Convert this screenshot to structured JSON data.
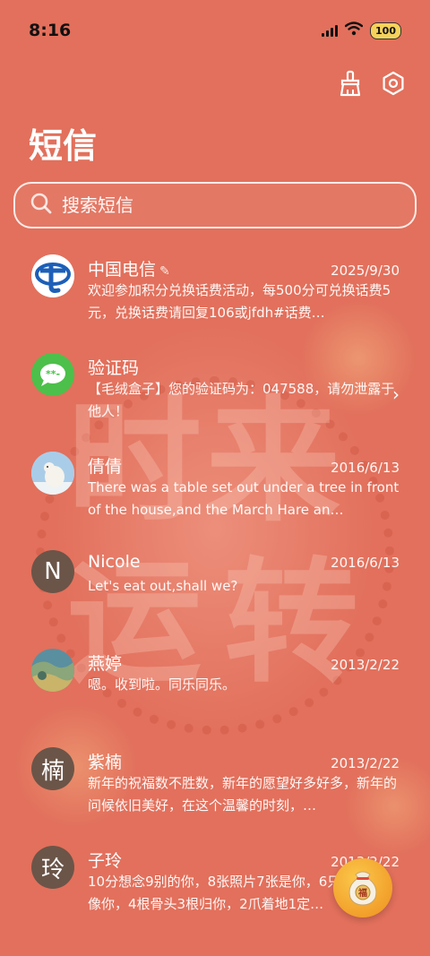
{
  "status": {
    "time": "8:16",
    "battery": "100"
  },
  "header": {
    "title": "短信"
  },
  "search": {
    "placeholder": "搜索短信"
  },
  "conversations": [
    {
      "name": "中国电信",
      "date": "2025/9/30",
      "preview": "欢迎参加积分兑换话费活动，每500分可兑换话费5元，兑换话费请回复106或jfdh#话费…",
      "avatar": "telecom-logo"
    },
    {
      "name": "验证码",
      "date": "",
      "preview": "【毛绒盒子】您的验证码为：047588，请勿泄露于他人！",
      "avatar": "message-bubble"
    },
    {
      "name": "倩倩",
      "date": "2016/6/13",
      "preview": "There was a table set out under a tree in front of the house,and the March Hare an…",
      "avatar": "polar-bear-photo"
    },
    {
      "name": "Nicole",
      "date": "2016/6/13",
      "preview": "Let's eat out,shall we?",
      "avatar_letter": "N"
    },
    {
      "name": "燕婷",
      "date": "2013/2/22",
      "preview": "嗯。收到啦。同乐同乐。",
      "avatar": "landscape-photo"
    },
    {
      "name": "紫楠",
      "date": "2013/2/22",
      "preview": "新年的祝福数不胜数，新年的愿望好多好多，新年的问候依旧美好，在这个温馨的时刻，…",
      "avatar_letter": "楠"
    },
    {
      "name": "子玲",
      "date": "2013/2/22",
      "preview": "10分想念9别的你，8张照片7张是你，6只小狗5只像你，4根骨头3根归你，2爪着地1定…",
      "avatar_letter": "玲"
    }
  ],
  "colors": {
    "background": "#e2705c",
    "avatar_letter_bg": "#6b5548",
    "verify_green": "#4cc04a",
    "telecom_blue": "#1c5fb8"
  },
  "fab": {
    "icon": "lucky-bag-icon",
    "label": "福"
  }
}
